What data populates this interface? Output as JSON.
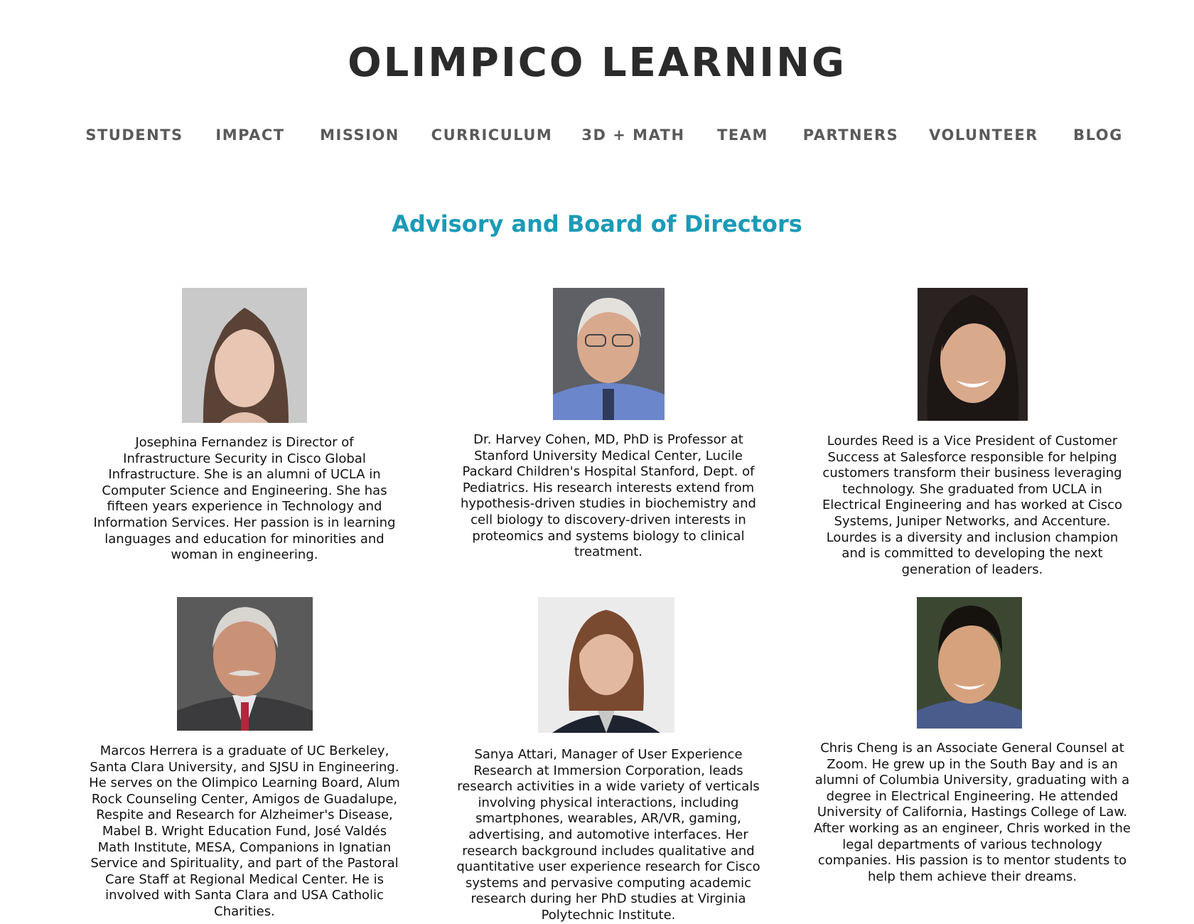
{
  "site": {
    "title": "OLIMPICO LEARNING"
  },
  "nav": {
    "items": [
      {
        "label": "STUDENTS"
      },
      {
        "label": "IMPACT"
      },
      {
        "label": "MISSION"
      },
      {
        "label": "CURRICULUM"
      },
      {
        "label": "3D + MATH"
      },
      {
        "label": "TEAM"
      },
      {
        "label": "PARTNERS"
      },
      {
        "label": "VOLUNTEER"
      },
      {
        "label": "BLOG"
      }
    ]
  },
  "section": {
    "heading": "Advisory and Board of Directors"
  },
  "colors": {
    "accent": "#1a9bb7",
    "title": "#2b2b2b",
    "nav": "#5a5a5a"
  },
  "members": [
    {
      "photo": "headshot-woman-long-brown-hair",
      "bio": "Josephina Fernandez is Director of Infrastructure Security in Cisco Global Infrastructure. She is an alumni of UCLA in Computer Science and Engineering. She has fifteen years experience in Technology and Information Services. Her passion is in learning languages and education for minorities and woman in engineering."
    },
    {
      "photo": "headshot-older-man-glasses-blue-shirt",
      "bio": "Dr. Harvey Cohen, MD, PhD is Professor at Stanford University Medical Center, Lucile Packard Children's Hospital Stanford, Dept. of Pediatrics. His research interests extend from hypothesis-driven studies in biochemistry and cell biology to discovery-driven interests in proteomics and systems biology to clinical treatment."
    },
    {
      "photo": "headshot-smiling-woman-dark-hair",
      "bio": "Lourdes Reed is a Vice President of Customer Success at Salesforce responsible for helping customers transform their business leveraging technology. She graduated from UCLA in Electrical Engineering and has worked at Cisco Systems, Juniper Networks, and Accenture. Lourdes is a diversity and inclusion champion and is committed to developing the next generation of leaders."
    },
    {
      "photo": "headshot-man-gray-hair-mustache-suit",
      "bio": "Marcos Herrera is a graduate of UC Berkeley, Santa Clara University, and SJSU in Engineering. He serves on the Olimpico Learning Board, Alum Rock Counseling Center, Amigos de Guadalupe, Respite and Research for Alzheimer's Disease, Mabel B. Wright Education Fund, José Valdés Math Institute, MESA, Companions in Ignatian Service and Spirituality, and part of the Pastoral Care Staff at Regional Medical Center. He is involved with Santa Clara and USA Catholic Charities."
    },
    {
      "photo": "headshot-woman-brown-hair-blazer",
      "bio": "Sanya Attari, Manager of User Experience Research at Immersion Corporation, leads research activities in a wide variety of verticals involving physical interactions, including smartphones, wearables, AR/VR, gaming, advertising, and automotive interfaces. Her research background includes qualitative and quantitative user experience research for Cisco systems and pervasive computing academic research during her PhD studies at Virginia Polytechnic Institute."
    },
    {
      "photo": "headshot-smiling-man-short-black-hair",
      "bio": "Chris Cheng is an Associate General Counsel at Zoom. He grew up in the South Bay and is an alumni of Columbia University, graduating with a degree in Electrical Engineering. He attended University of California, Hastings College of Law. After working as an engineer, Chris worked in the legal departments of various technology companies. His passion is to mentor students to help them achieve their dreams."
    }
  ]
}
